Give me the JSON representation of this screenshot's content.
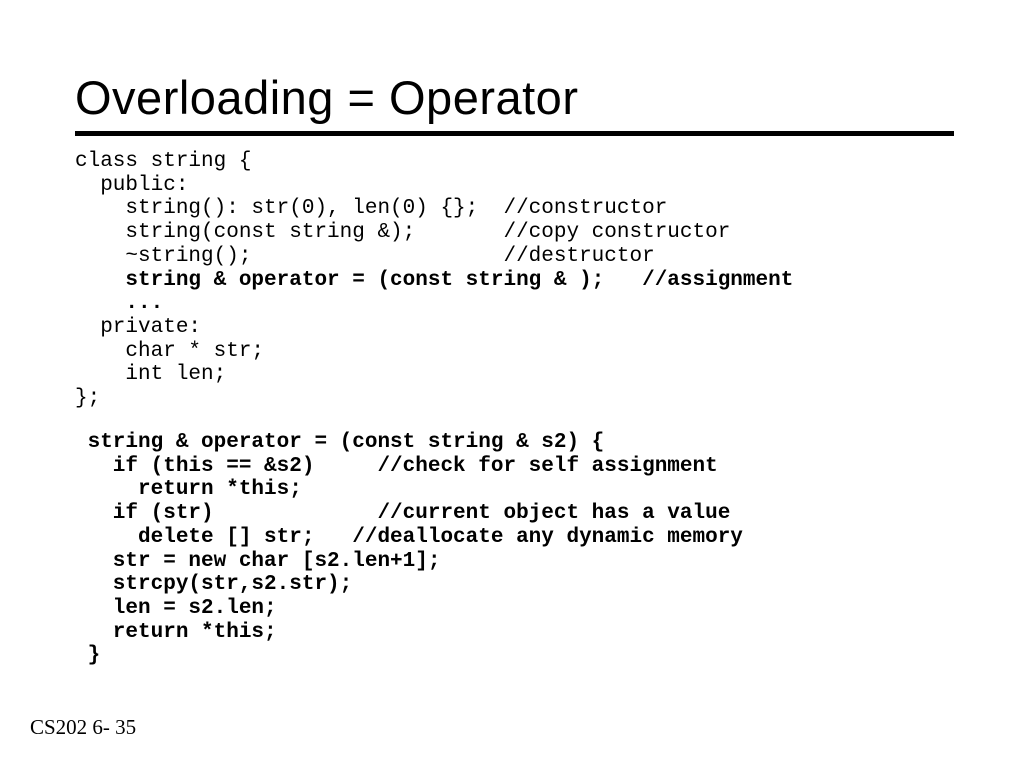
{
  "title": "Overloading = Operator",
  "code": {
    "l1": "class string {",
    "l2": "  public:",
    "l3": "    string(): str(0), len(0) {};  //constructor",
    "l4": "    string(const string &);       //copy constructor",
    "l5": "    ~string();                    //destructor",
    "l6": "    string & operator = (const string & );   //assignment",
    "l7": "    ...",
    "l8": "  private:",
    "l9": "    char * str;",
    "l10": "    int len;",
    "l11": "};",
    "m1": " string & operator = (const string & s2) {",
    "m2": "   if (this == &s2)     //check for self assignment",
    "m3": "     return *this;",
    "m4": "   if (str)             //current object has a value",
    "m5": "     delete [] str;   //deallocate any dynamic memory",
    "m6": "   str = new char [s2.len+1];",
    "m7": "   strcpy(str,s2.str);",
    "m8": "   len = s2.len;",
    "m9": "   return *this;",
    "m10": " }"
  },
  "footer": "CS202 6- 35"
}
